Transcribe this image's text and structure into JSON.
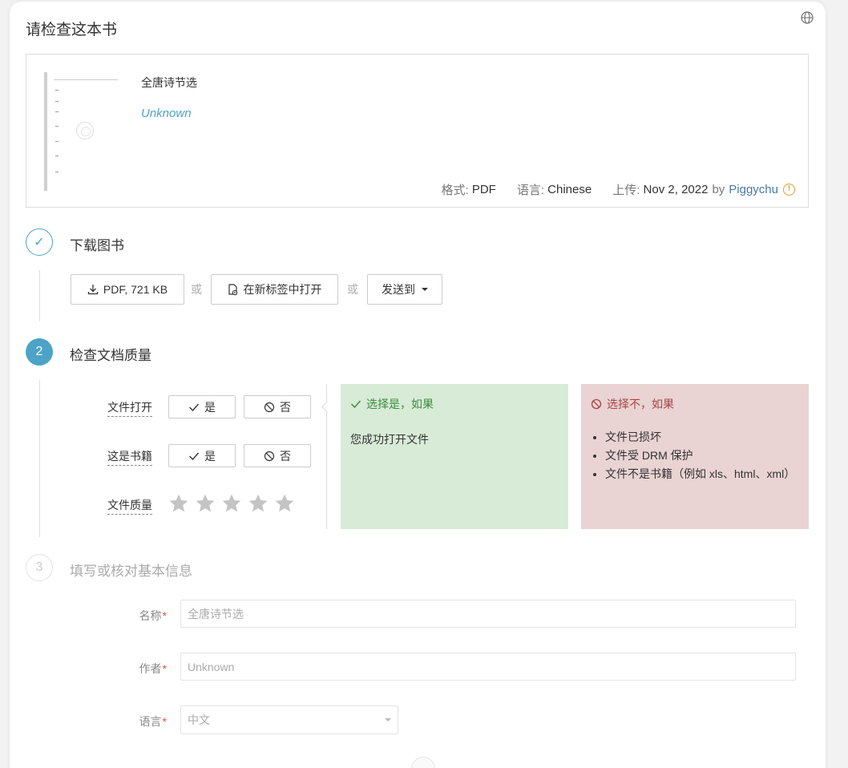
{
  "header": {
    "title": "请检查这本书"
  },
  "book": {
    "title": "全唐诗节选",
    "author": "Unknown",
    "format_label": "格式:",
    "format": "PDF",
    "language_label": "语言:",
    "language": "Chinese",
    "upload_label": "上传:",
    "upload_date": "Nov 2, 2022",
    "by": "by",
    "uploader": "Piggychu",
    "warn_glyph": "!"
  },
  "step1": {
    "number": "✓",
    "title": "下载图书",
    "download_label": "PDF, 721 KB",
    "or": "或",
    "open_new_tab_label": "在新标签中打开",
    "send_to_label": "发送到"
  },
  "step2": {
    "number": "2",
    "title": "检查文档质量",
    "q_file_opens": "文件打开",
    "q_is_book": "这是书籍",
    "q_quality": "文件质量",
    "yes": "是",
    "no": "否",
    "rating": 0,
    "yes_panel": {
      "heading": "选择是，如果",
      "text": "您成功打开文件"
    },
    "no_panel": {
      "heading": "选择不，如果",
      "items": [
        "文件已损坏",
        "文件受 DRM 保护",
        "文件不是书籍（例如 xls、html、xml）"
      ]
    }
  },
  "step3": {
    "number": "3",
    "title": "填写或核对基本信息",
    "name_label": "名称",
    "name_value": "全唐诗节选",
    "author_label": "作者",
    "author_value": "Unknown",
    "lang_label": "语言",
    "lang_value": "中文",
    "required_mark": "*"
  },
  "colors": {
    "accent": "#4ba3c7",
    "yes_bg": "#d8ebd7",
    "no_bg": "#e9d3d3",
    "warn": "#e59a2a"
  }
}
